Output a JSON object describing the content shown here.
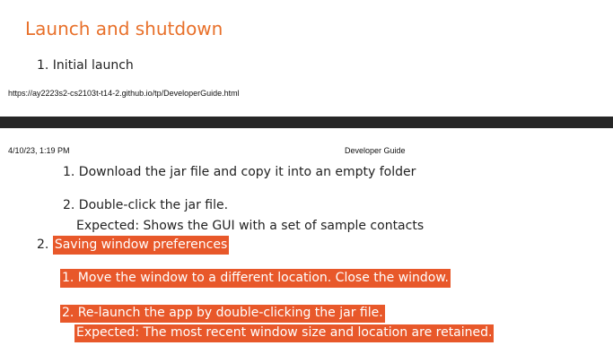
{
  "page": {
    "section_title": "Launch and shutdown",
    "item_initial_launch": "1. Initial launch",
    "url": "https://ay2223s2-cs2103t-t14-2.github.io/tp/DeveloperGuide.html",
    "print_datetime": "4/10/23, 1:19 PM",
    "print_title": "Developer Guide"
  },
  "steps": {
    "download": "1. Download the jar file and copy it into an empty folder",
    "double_click": "2. Double-click the jar file.",
    "double_click_expected": "Expected: Shows the GUI with a set of sample contacts",
    "saving_number": "2.",
    "saving_label": "Saving window preferences",
    "move_window": "1. Move the window to a different location. Close the window.",
    "relaunch": "2. Re-launch the app by double-clicking the jar file.",
    "relaunch_expected": "Expected: The most recent window size and location are retained."
  },
  "colors": {
    "heading": "#e8702a",
    "highlight": "#e8582a",
    "page_break": "#262626"
  }
}
